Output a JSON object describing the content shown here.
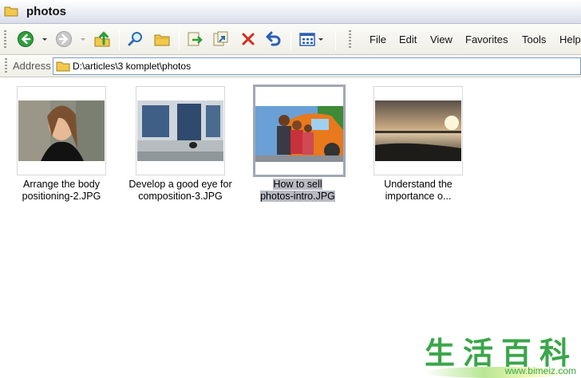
{
  "window": {
    "title": "photos"
  },
  "menu": [
    "File",
    "Edit",
    "View",
    "Favorites",
    "Tools",
    "Help"
  ],
  "address": {
    "label": "Address",
    "path": "D:\\articles\\3 komplet\\photos"
  },
  "files": [
    {
      "caption_line1": "Arrange the body",
      "caption_line2": "positioning-2.JPG",
      "selected": false
    },
    {
      "caption_line1": "Develop a good eye for",
      "caption_line2": "composition-3.JPG",
      "selected": false
    },
    {
      "caption_line1": "How to sell",
      "caption_line2": "photos-intro.JPG",
      "selected": true
    },
    {
      "caption_line1": "Understand the",
      "caption_line2": "importance o...",
      "selected": false
    }
  ],
  "watermark": {
    "chars": "生活百科",
    "url": "www.bimeiz.com"
  },
  "colors": {
    "folder": "#f2c94c",
    "back_green": "#2e9e3c",
    "delete_red": "#d42b1e",
    "selection": "#b7bac3"
  }
}
